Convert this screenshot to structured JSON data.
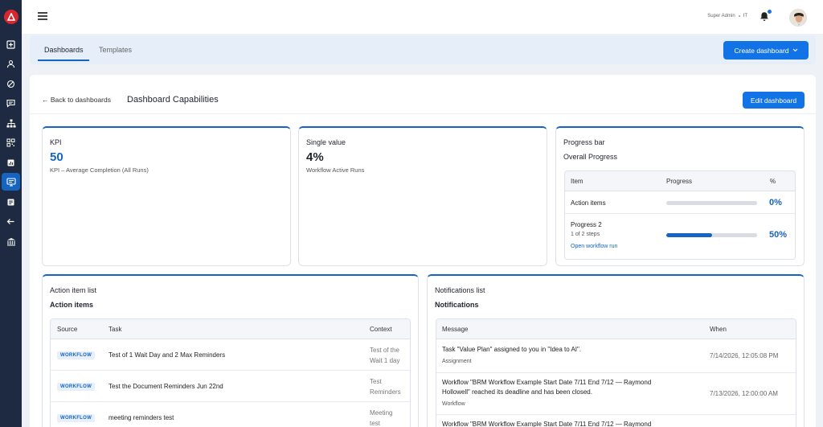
{
  "header": {
    "user_name": "Super Admin",
    "user_dept": "IT"
  },
  "tabs": [
    {
      "label": "Dashboards"
    },
    {
      "label": "Templates"
    }
  ],
  "create_button": "Create dashboard",
  "main": {
    "back_link": "← Back to dashboards",
    "title": "Dashboard Capabilities",
    "edit_button": "Edit dashboard"
  },
  "kpi": {
    "title": "KPI",
    "value": "50",
    "caption": "KPI – Average Completion (All Runs)"
  },
  "single_value": {
    "title": "Single value",
    "value": "4%",
    "caption": "Workflow Active Runs"
  },
  "progress": {
    "title": "Progress bar",
    "subtitle": "Overall Progress",
    "headers": {
      "item": "Item",
      "progress": "Progress",
      "pct": "%"
    },
    "rows": [
      {
        "item": "Action items",
        "steps": "",
        "link": "",
        "fraction": 0,
        "pct": "0%"
      },
      {
        "item": "Progress 2",
        "steps": "1 of 2 steps",
        "link": "Open workflow run",
        "fraction": 0.5,
        "pct": "50%"
      }
    ]
  },
  "action_list": {
    "title": "Action item list",
    "subtitle": "Action items",
    "headers": {
      "source": "Source",
      "task": "Task",
      "context": "Context"
    },
    "rows": [
      {
        "source": "WORKFLOW",
        "task": "Test of 1 Wait Day and 2 Max Reminders",
        "context1": "Test of the",
        "context2": "Wait 1 day"
      },
      {
        "source": "WORKFLOW",
        "task": "Test the Document Reminders Jun 22nd",
        "context1": "Test",
        "context2": "Reminders"
      },
      {
        "source": "WORKFLOW",
        "task": "meeting reminders test",
        "context1": "Meeting",
        "context2": "test"
      }
    ]
  },
  "notifications": {
    "title": "Notifications list",
    "subtitle": "Notifications",
    "headers": {
      "message": "Message",
      "when": "When"
    },
    "rows": [
      {
        "message1": "Task \"Value Plan\" assigned to you in \"Idea to AI\".",
        "message2": "",
        "type": "Assignment",
        "when": "7/14/2026, 12:05:08 PM"
      },
      {
        "message1": "Workflow \"BRM Workflow Example Start Date 7/11 End 7/12 — Raymond",
        "message2": "Hollowell\" reached its deadline and has been closed.",
        "type": "Workflow",
        "when": "7/13/2026, 12:00:00 AM"
      },
      {
        "message1": "Workflow \"BRM Workflow Example Start Date 7/11 End 7/12 — Raymond",
        "message2": "",
        "type": "",
        "when": ""
      }
    ]
  },
  "colors": {
    "accent": "#1565c0",
    "button": "#1273e6",
    "sidebar": "#1d2a42",
    "logo": "#d7262d"
  },
  "icons": {
    "sidebar": [
      "plus-square-icon",
      "person-icon",
      "tag-icon",
      "chat-icon",
      "org-chart-icon",
      "qr-icon",
      "chart-icon",
      "monitor-icon",
      "list-icon",
      "arrow-left-icon",
      "bank-icon"
    ]
  }
}
